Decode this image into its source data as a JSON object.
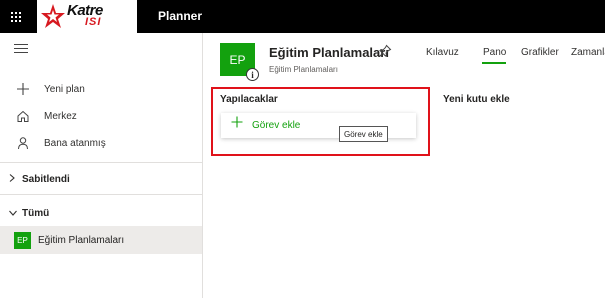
{
  "header": {
    "app_title": "Planner",
    "logo_main": "Katre",
    "logo_sub": "ISI"
  },
  "sidebar": {
    "nav": [
      {
        "label": "Yeni plan",
        "icon": "plus-icon"
      },
      {
        "label": "Merkez",
        "icon": "home-icon"
      },
      {
        "label": "Bana atanmış",
        "icon": "person-icon"
      }
    ],
    "sections": {
      "pinned": "Sabitlendi",
      "all": "Tümü"
    },
    "plans": [
      {
        "badge": "EP",
        "label": "Eğitim Planlamaları"
      }
    ]
  },
  "plan": {
    "avatar": "EP",
    "title": "Eğitim Planlamaları",
    "subtitle": "Eğitim Planlamaları",
    "accent": "#13a10e"
  },
  "tabs": [
    {
      "label": "Kılavuz",
      "active": false
    },
    {
      "label": "Pano",
      "active": true
    },
    {
      "label": "Grafikler",
      "active": false
    },
    {
      "label": "Zamanla",
      "active": false
    }
  ],
  "board": {
    "bucket_name": "Yapılacaklar",
    "add_task_label": "Görev ekle",
    "tooltip": "Görev ekle",
    "new_bucket_label": "Yeni kutu ekle",
    "highlight_color": "#e0121a"
  }
}
